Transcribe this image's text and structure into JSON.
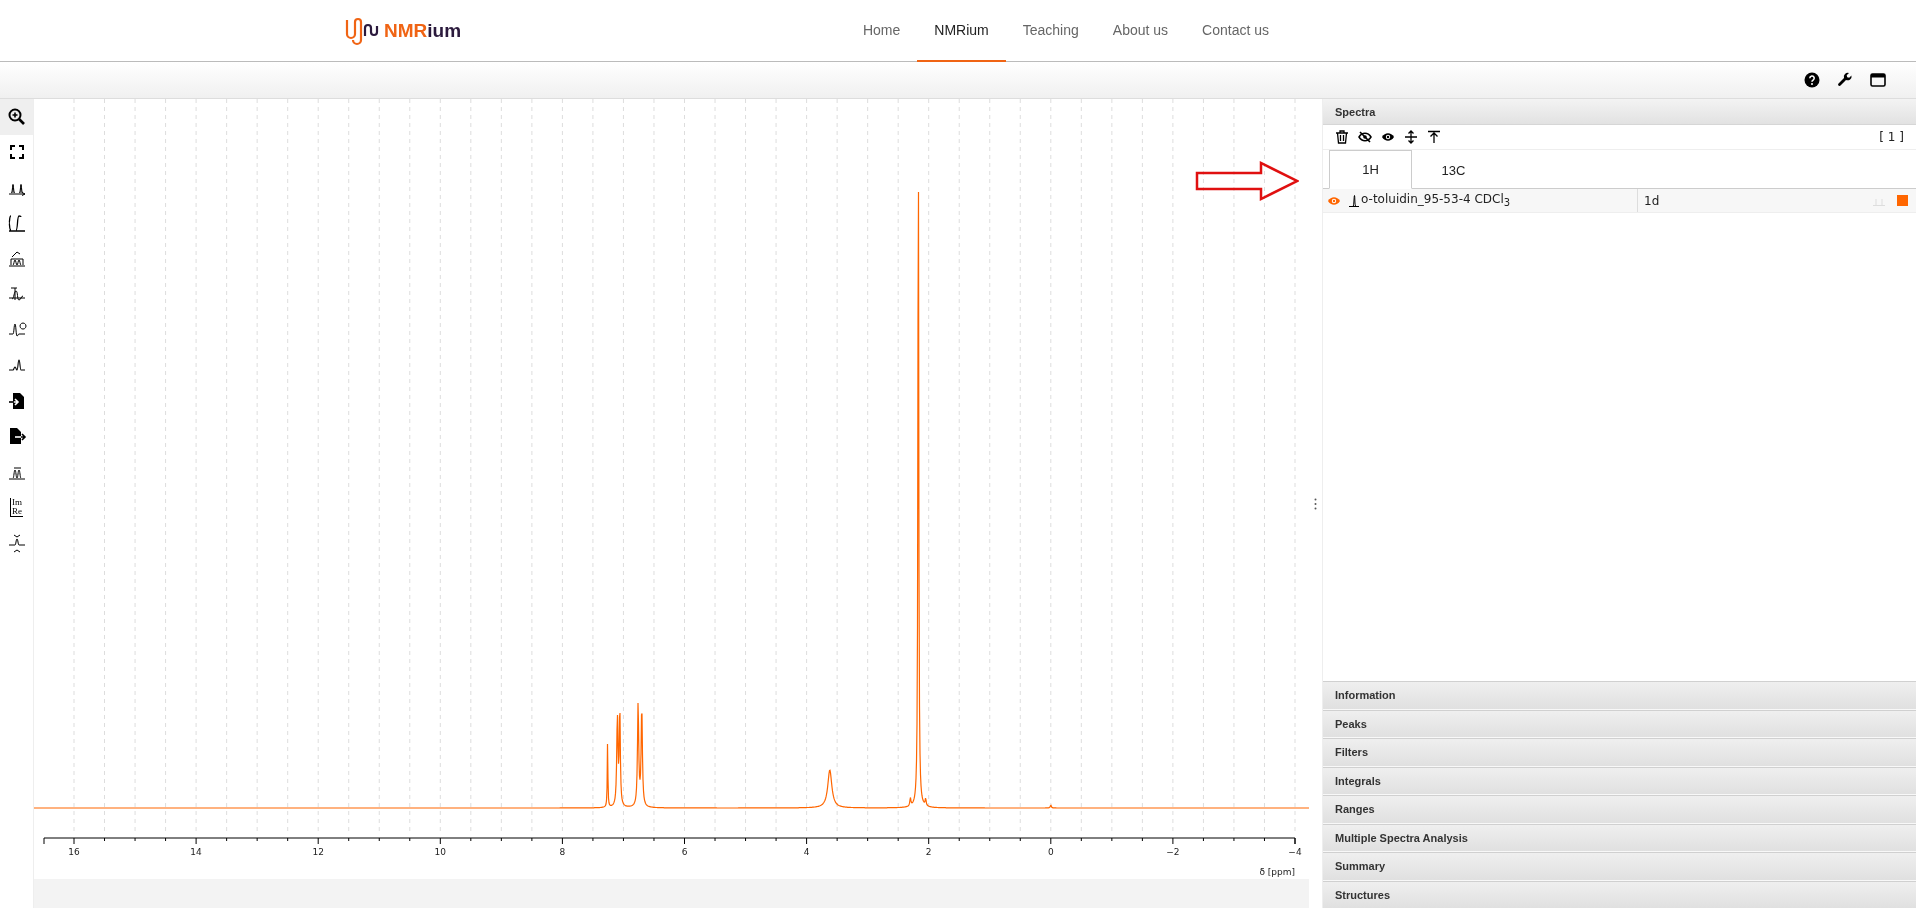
{
  "header": {
    "logo": {
      "accent": "NMR",
      "rest": "ium"
    },
    "nav": [
      {
        "label": "Home",
        "selected": false
      },
      {
        "label": "NMRium",
        "selected": true
      },
      {
        "label": "Teaching",
        "selected": false
      },
      {
        "label": "About us",
        "selected": false
      },
      {
        "label": "Contact us",
        "selected": false
      }
    ]
  },
  "tools": [
    {
      "kind": "zoom",
      "selected": true
    },
    {
      "kind": "fullscreen",
      "selected": false
    },
    {
      "kind": "peaks",
      "selected": false
    },
    {
      "kind": "integral",
      "selected": false
    },
    {
      "kind": "multiplet",
      "selected": false
    },
    {
      "kind": "baseline",
      "selected": false
    },
    {
      "kind": "phase",
      "selected": false
    },
    {
      "kind": "apodization",
      "selected": false
    },
    {
      "kind": "import",
      "selected": false
    },
    {
      "kind": "export",
      "selected": false
    },
    {
      "kind": "ranges",
      "selected": false
    },
    {
      "kind": "imre",
      "labels": [
        "Im",
        "Re"
      ],
      "selected": false
    },
    {
      "kind": "exclusion",
      "selected": false
    }
  ],
  "axis": {
    "ticks": [
      "16",
      "14",
      "12",
      "10",
      "8",
      "6",
      "4",
      "2",
      "0",
      "−2",
      "−4"
    ],
    "label": "δ [ppm]"
  },
  "spectra_panel": {
    "title": "Spectra",
    "count": "[ 1 ]",
    "tabs": [
      {
        "label": "1H",
        "selected": true
      },
      {
        "label": "13C",
        "selected": false
      }
    ],
    "rows": [
      {
        "visible": true,
        "name": "o-toluidin_95-53-4  CDCl$_{3}$",
        "type": "1d",
        "color": "#ff6600"
      }
    ]
  },
  "panels": [
    {
      "title": "Information"
    },
    {
      "title": "Peaks"
    },
    {
      "title": "Filters"
    },
    {
      "title": "Integrals"
    },
    {
      "title": "Ranges"
    },
    {
      "title": "Multiple Spectra Analysis"
    },
    {
      "title": "Summary"
    },
    {
      "title": "Structures"
    }
  ]
}
